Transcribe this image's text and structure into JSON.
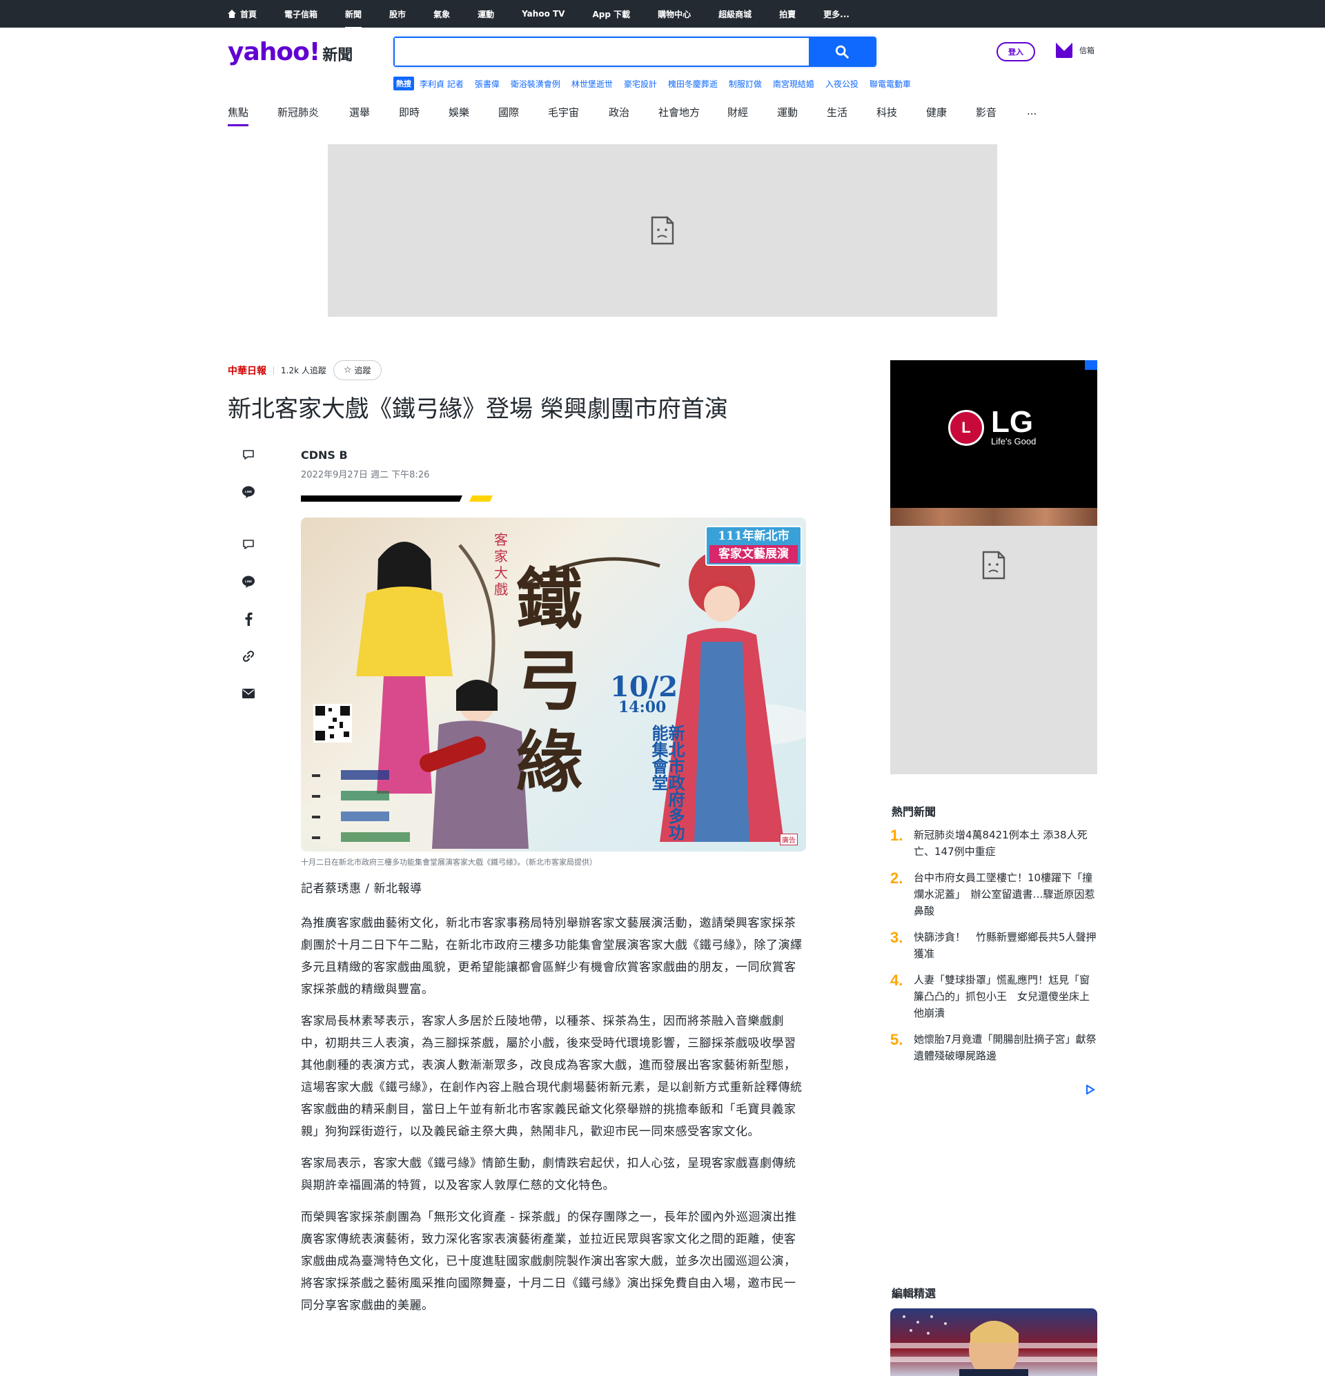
{
  "topbar": {
    "items": [
      "首頁",
      "電子信箱",
      "新聞",
      "股市",
      "氣象",
      "運動",
      "Yahoo TV",
      "App 下載",
      "購物中心",
      "超級商城",
      "拍賣",
      "更多..."
    ],
    "active_index": 2
  },
  "header": {
    "logo_text": "yahoo!",
    "logo_section": "新聞",
    "search": {
      "value": "",
      "placeholder": ""
    },
    "hot_tag": "熱搜",
    "hot_links": [
      "李利貞 記者",
      "張書偉",
      "衛浴裝潢會例",
      "林世堡逝世",
      "豪宅設計",
      "槐田冬慶葬逝",
      "制服訂做",
      "南宮現結婚",
      "入夜公投",
      "聯電電動車"
    ],
    "login_label": "登入",
    "mail_label": "信箱"
  },
  "categories": {
    "items": [
      "焦點",
      "新冠肺炎",
      "選舉",
      "即時",
      "娛樂",
      "國際",
      "毛宇宙",
      "政治",
      "社會地方",
      "財經",
      "運動",
      "生活",
      "科技",
      "健康",
      "影音",
      "..."
    ],
    "active_index": 0
  },
  "article": {
    "source_name": "中華日報",
    "followers": "1.2k 人追蹤",
    "follow_label": "追蹤",
    "title": "新北客家大戲《鐵弓緣》登場 榮興劇團市府首演",
    "author": "CDNS B",
    "date": "2022年9月27日 週二 下午8:26",
    "image": {
      "badge_line1": "111年新北市",
      "badge_line2": "客家文藝展演",
      "vertical_label": "客家大戲",
      "main_title": "鐵弓緣",
      "date_text": "10/2",
      "time_text": "14:00",
      "venue": "新北市政府多功能集會堂",
      "ad_tag": "廣告"
    },
    "caption": "十月二日在新北市政府三樓多功能集會堂展演客家大戲《鐵弓緣》。（新北市客家局提供）",
    "lead": "記者蔡琇惠 / 新北報導",
    "paragraphs": [
      "為推廣客家戲曲藝術文化，新北市客家事務局特別舉辦客家文藝展演活動，邀請榮興客家採茶劇團於十月二日下午二點，在新北市政府三樓多功能集會堂展演客家大戲《鐵弓緣》，除了演繹多元且精緻的客家戲曲風貌，更希望能讓都會區鮮少有機會欣賞客家戲曲的朋友，一同欣賞客家採茶戲的精緻與豐富。",
      "客家局長林素琴表示，客家人多居於丘陵地帶，以種茶、採茶為生，因而將茶融入音樂戲劇中，初期共三人表演，為三腳採茶戲，屬於小戲，後來受時代環境影響，三腳採茶戲吸收學習其他劇種的表演方式，表演人數漸漸眾多，改良成為客家大戲，進而發展出客家藝術新型態，這場客家大戲《鐵弓緣》，在創作內容上融合現代劇場藝術新元素，是以創新方式重新詮釋傳統客家戲曲的精采劇目，當日上午並有新北市客家義民爺文化祭舉辦的挑擔奉飯和「毛寶貝義家親」狗狗踩街遊行，以及義民爺主祭大典，熱鬧非凡，歡迎市民一同來感受客家文化。",
      "客家局表示，客家大戲《鐵弓緣》情節生動，劇情跌宕起伏，扣人心弦，呈現客家戲喜劇傳統與期許幸福圓滿的特質，以及客家人敦厚仁慈的文化特色。",
      "而榮興客家採茶劇團為「無形文化資產 - 採茶戲」的保存團隊之一，長年於國內外巡迴演出推廣客家傳統表演藝術，致力深化客家表演藝術產業，並拉近民眾與客家文化之間的距離，使客家戲曲成為臺灣特色文化，已十度進駐國家戲劇院製作演出客家大戲，並多次出國巡迴公演，將客家採茶戲之藝術風采推向國際舞臺，十月二日《鐵弓緣》演出採免費自由入場，邀市民一同分享客家戲曲的美麗。"
    ]
  },
  "sidebar": {
    "ad": {
      "brand": "LG",
      "tagline": "Life's Good"
    },
    "trending_title": "熱門新聞",
    "trending": [
      {
        "num": "1.",
        "text": "新冠肺炎增4萬8421例本土 添38人死亡、147例中重症"
      },
      {
        "num": "2.",
        "text": "台中市府女員工墜樓亡！10樓躍下「撞爛水泥蓋」　辦公室留遺書…驟逝原因惹鼻酸"
      },
      {
        "num": "3.",
        "text": "快篩涉貪！　竹縣新豐鄉鄉長共5人聲押獲准"
      },
      {
        "num": "4.",
        "text": "人妻「雙球掛罩」慌亂應門！尪見「窗簾凸凸的」抓包小王　女兒還傻坐床上他崩潰"
      },
      {
        "num": "5.",
        "text": "她懷胎7月竟遭「開腸剖肚摘子宮」獻祭　遺體殘破曝屍路邊"
      }
    ],
    "editor_title": "編輯精選"
  },
  "colors": {
    "brand": "#6001d2",
    "accent": "#0f69ff",
    "topbar": "#232a31",
    "rank": "#ffa700"
  }
}
